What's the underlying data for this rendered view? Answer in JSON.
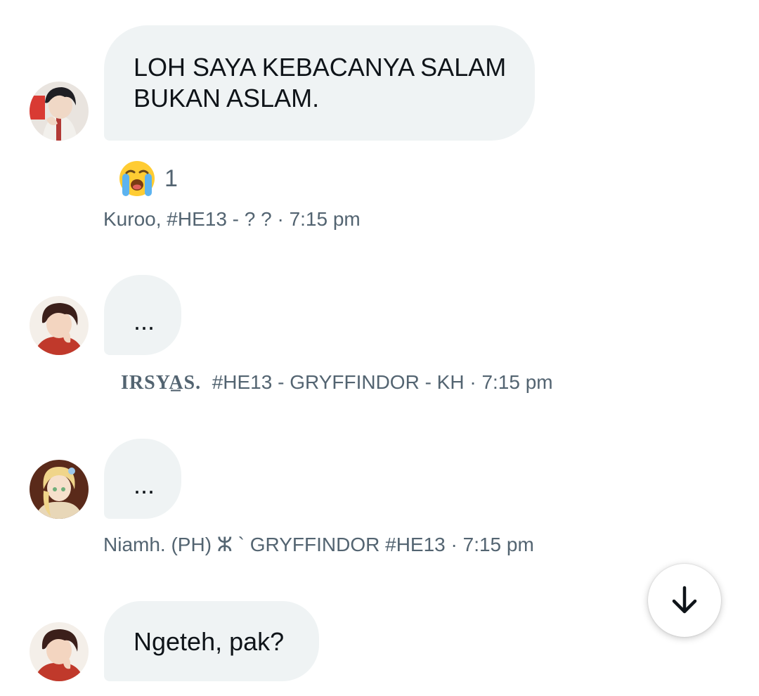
{
  "messages": [
    {
      "text": "LOH SAYA KEBACANYA SALAM\nBUKAN ASLAM.",
      "reaction": {
        "emoji": "loudly-crying-face",
        "count": "1"
      },
      "meta": "Kuroo, #HE13 - ? ? · 7:15 pm",
      "avatar": "avatar-dark-hair-character"
    },
    {
      "text": "...",
      "meta_name": "IRSYA̲S.",
      "meta_rest": "#HE13 - GRYFFINDOR - KH · 7:15 pm",
      "avatar": "avatar-red-hair-character"
    },
    {
      "text": "...",
      "meta": "Niamh. (PH) ⵣ ` GRYFFINDOR #HE13 · 7:15 pm",
      "avatar": "avatar-blonde-elf-character"
    },
    {
      "text": "Ngeteh, pak?",
      "avatar": "avatar-red-hair-character"
    }
  ],
  "scroll_button": {
    "icon": "arrow-down-icon"
  },
  "colors": {
    "bubble": "#eff3f4",
    "text": "#0f1419",
    "meta": "#536471",
    "background": "#ffffff"
  }
}
